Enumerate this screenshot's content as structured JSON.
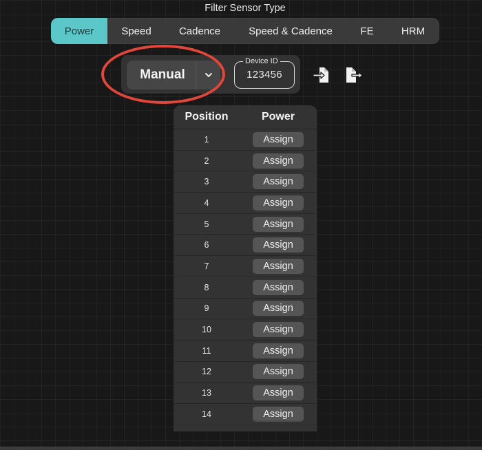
{
  "filter": {
    "title": "Filter Sensor Type",
    "tabs": [
      {
        "label": "Power",
        "active": true
      },
      {
        "label": "Speed",
        "active": false
      },
      {
        "label": "Cadence",
        "active": false
      },
      {
        "label": "Speed & Cadence",
        "active": false
      },
      {
        "label": "FE",
        "active": false
      },
      {
        "label": "HRM",
        "active": false
      }
    ]
  },
  "device": {
    "mode_label": "Manual",
    "device_id_label": "Device ID",
    "device_id_value": "123456"
  },
  "icons": {
    "mode_chevron": "chevron-down-icon",
    "import": "import-icon",
    "export": "export-icon"
  },
  "table": {
    "headers": {
      "position": "Position",
      "power": "Power"
    },
    "rows": [
      {
        "position": "1",
        "action": "Assign"
      },
      {
        "position": "2",
        "action": "Assign"
      },
      {
        "position": "3",
        "action": "Assign"
      },
      {
        "position": "4",
        "action": "Assign"
      },
      {
        "position": "5",
        "action": "Assign"
      },
      {
        "position": "6",
        "action": "Assign"
      },
      {
        "position": "7",
        "action": "Assign"
      },
      {
        "position": "8",
        "action": "Assign"
      },
      {
        "position": "9",
        "action": "Assign"
      },
      {
        "position": "10",
        "action": "Assign"
      },
      {
        "position": "11",
        "action": "Assign"
      },
      {
        "position": "12",
        "action": "Assign"
      },
      {
        "position": "13",
        "action": "Assign"
      },
      {
        "position": "14",
        "action": "Assign"
      }
    ]
  },
  "colors": {
    "accent": "#5bc7c9",
    "highlight_ring": "#e0473a",
    "background": "#181818",
    "panel": "#333333",
    "button": "#555555"
  }
}
